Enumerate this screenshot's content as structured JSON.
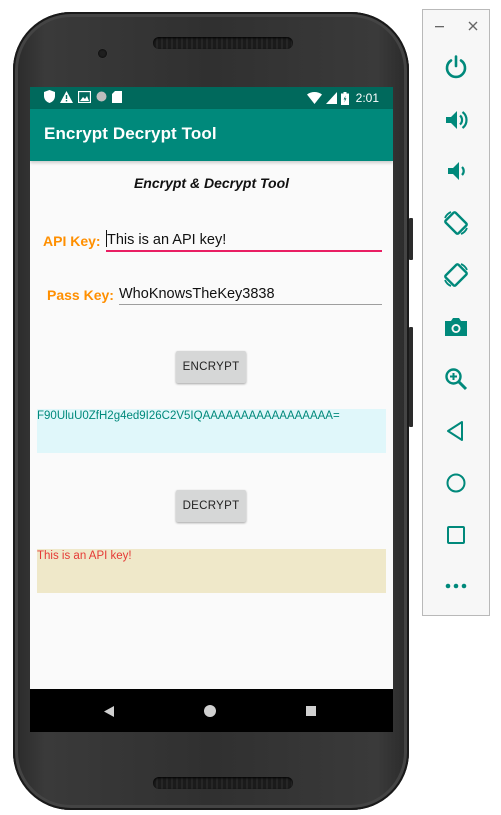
{
  "status_bar": {
    "time": "2:01"
  },
  "app_bar": {
    "title": "Encrypt Decrypt Tool"
  },
  "main": {
    "heading": "Encrypt & Decrypt Tool",
    "api_key": {
      "label": "API Key:",
      "value": "This is an API key!"
    },
    "pass_key": {
      "label": "Pass Key:",
      "value": "WhoKnowsTheKey3838"
    },
    "encrypt_button": "ENCRYPT",
    "encrypted_output": "F90UluU0ZfH2g4ed9I26C2V5IQAAAAAAAAAAAAAAAAA=",
    "decrypt_button": "DECRYPT",
    "decrypted_output": "This is an API key!"
  },
  "emulator_toolbar": {
    "window_controls": [
      "minimize-icon",
      "close-icon"
    ],
    "buttons": [
      "power-icon",
      "volume-up-icon",
      "volume-down-icon",
      "rotate-left-icon",
      "rotate-right-icon",
      "camera-icon",
      "zoom-icon",
      "back-icon",
      "home-icon",
      "overview-icon",
      "more-icon"
    ]
  },
  "colors": {
    "status_bar": "#00695c",
    "app_bar": "#00897b",
    "label": "#ff8f00",
    "field_focus": "#e91e63",
    "encrypted_bg": "#e0f7fa",
    "encrypted_text": "#00897b",
    "decrypted_bg": "#efe8c9",
    "decrypted_text": "#e53935",
    "emulator_icon": "#00897b"
  }
}
